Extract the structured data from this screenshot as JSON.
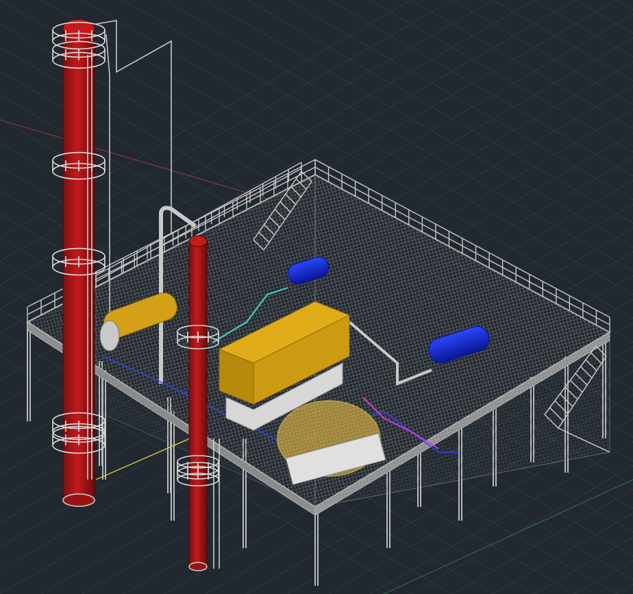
{
  "viewport": {
    "background": "#212830",
    "grid_color": "#2f3742",
    "axis_x_color": "#a03a3a",
    "axis_y_color": "#2f7a3a"
  },
  "model": {
    "structure_color": "#bcbcbc",
    "column_color": "#c04a50",
    "column_shade": "#7a0f10",
    "tank_color": "#d4a017",
    "tank_shade": "#8a6a08",
    "exchanger_color": "#0a22c8",
    "pipe_color": "#4bc7c2",
    "magenta_color": "#d63ad6",
    "components": [
      {
        "name": "tall-column"
      },
      {
        "name": "short-column"
      },
      {
        "name": "elevated-platform"
      },
      {
        "name": "process-tank"
      },
      {
        "name": "heat-exchanger"
      },
      {
        "name": "rotary-drum"
      },
      {
        "name": "stairway"
      }
    ]
  }
}
